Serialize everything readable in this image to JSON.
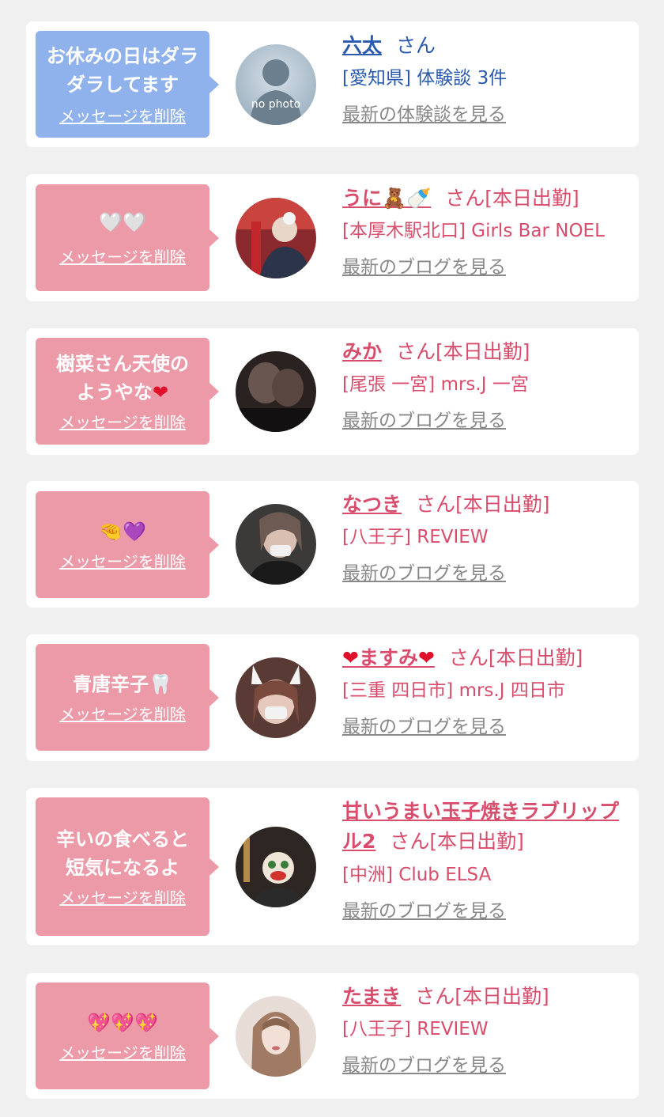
{
  "delete_label": "メッセージを削除",
  "colors": {
    "bubble_blue": "#8fb2ec",
    "bubble_pink": "#ed9aa8",
    "name_blue": "#2a5ab0",
    "name_pink": "#d84d6b",
    "link_gray": "#888888",
    "background": "#f0f0f0"
  },
  "cards": [
    {
      "bubble_text": "お休みの日はダラダラしてます",
      "avatar_alt": "no photo",
      "name": "六太",
      "suffix": "さん",
      "shop": "[愛知県] 体験談 3件",
      "latest_link": "最新の体験談を見る"
    },
    {
      "bubble_text": "🤍🤍",
      "name": "うに🧸🍼",
      "suffix": "さん[本日出勤]",
      "shop": "[本厚木駅北口] Girls Bar NOEL",
      "latest_link": "最新のブログを見る"
    },
    {
      "bubble_text_a": "樹菜さん天使のようやな",
      "bubble_text_b": "❤",
      "name": "みか",
      "suffix": "さん[本日出勤]",
      "shop": "[尾張 一宮] mrs.J 一宮",
      "latest_link": "最新のブログを見る"
    },
    {
      "bubble_text_a": "🤏",
      "bubble_text_b": "💜",
      "name": "なつき",
      "suffix": "さん[本日出勤]",
      "shop": "[八王子] REVIEW",
      "latest_link": "最新のブログを見る"
    },
    {
      "bubble_text_a": "青唐辛子",
      "bubble_text_b": "🦷",
      "name_a": "❤",
      "name_b": "ますみ",
      "name_c": "❤",
      "suffix": "さん[本日出勤]",
      "shop": "[三重 四日市] mrs.J 四日市",
      "latest_link": "最新のブログを見る"
    },
    {
      "bubble_text": "辛いの食べると短気になるよ",
      "name": "甘いうまい玉子焼きラブリップル2",
      "suffix": "さん[本日出勤]",
      "shop": "[中洲] Club ELSA",
      "latest_link": "最新のブログを見る"
    },
    {
      "bubble_text": "💖💖💖",
      "name": "たまき",
      "suffix": "さん[本日出勤]",
      "shop": "[八王子] REVIEW",
      "latest_link": "最新のブログを見る"
    }
  ]
}
